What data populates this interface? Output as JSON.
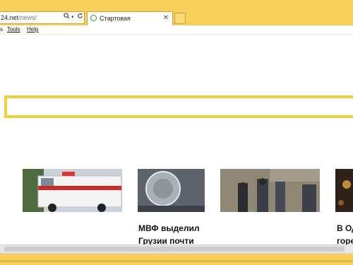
{
  "browser": {
    "address": {
      "domain": "24.net",
      "path": "/news/",
      "search_icon": "search-icon",
      "dropdown_icon": "chevron-down-icon",
      "refresh_icon": "refresh-icon"
    },
    "tabs": [
      {
        "title": "Стартовая",
        "favicon": "green-circle-icon",
        "close": "✕"
      }
    ],
    "menu": [
      {
        "label": "s"
      },
      {
        "label": "Tools"
      },
      {
        "label": "Help"
      }
    ],
    "accent_color": "#f6cf5b"
  },
  "content": {
    "search": {
      "border_color": "#f0cd3b"
    },
    "news": [
      {
        "image": "ambulance-photo",
        "headline_lines": []
      },
      {
        "image": "imf-logo-photo",
        "headline_lines": [
          "МВФ выделил",
          "Грузии почти"
        ]
      },
      {
        "image": "police-officers-photo",
        "headline_lines": []
      },
      {
        "image": "night-crowd-photo",
        "headline_lines": [
          "В Од",
          "горе"
        ]
      }
    ]
  }
}
